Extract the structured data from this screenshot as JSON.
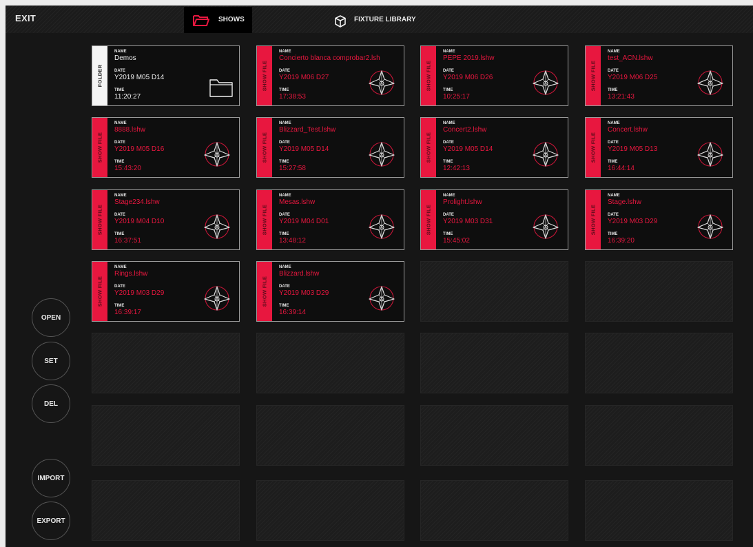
{
  "topbar": {
    "exit_label": "EXIT",
    "tabs": [
      {
        "label": "SHOWS",
        "icon": "folder-open-icon",
        "active": true
      },
      {
        "label": "FIXTURE LIBRARY",
        "icon": "cube-icon",
        "active": false
      }
    ]
  },
  "colors": {
    "accent": "#e8173f",
    "background": "#161616",
    "folder_strip": "#f4f4f4"
  },
  "sidebar": {
    "buttons": [
      {
        "label": "OPEN"
      },
      {
        "label": "SET"
      },
      {
        "label": "DEL"
      },
      {
        "label": "IMPORT"
      },
      {
        "label": "EXPORT"
      }
    ]
  },
  "field_labels": {
    "name": "NAME",
    "date": "DATE",
    "time": "TIME"
  },
  "shows": [
    {
      "kind": "FOLDER",
      "icon": "folder-icon",
      "name": "Demos",
      "date": "Y2019 M05 D14",
      "time": "11:20:27"
    },
    {
      "kind": "SHOW FILE",
      "icon": "moving-head-icon",
      "name": "Concierto blanca comprobar2.lsh",
      "date": "Y2019 M06 D27",
      "time": "17:38:53"
    },
    {
      "kind": "SHOW FILE",
      "icon": "moving-head-icon",
      "name": "PEPE 2019.lshw",
      "date": "Y2019 M06 D26",
      "time": "10:25:17"
    },
    {
      "kind": "SHOW FILE",
      "icon": "moving-head-icon",
      "name": "test_ACN.lshw",
      "date": "Y2019 M06 D25",
      "time": "13:21:43"
    },
    {
      "kind": "SHOW FILE",
      "icon": "moving-head-icon",
      "name": "8888.lshw",
      "date": "Y2019 M05 D16",
      "time": "15:43:20"
    },
    {
      "kind": "SHOW FILE",
      "icon": "moving-head-icon",
      "name": "Blizzard_Test.lshw",
      "date": "Y2019 M05 D14",
      "time": "15:27:58"
    },
    {
      "kind": "SHOW FILE",
      "icon": "moving-head-icon",
      "name": "Concert2.lshw",
      "date": "Y2019 M05 D14",
      "time": "12:42:13"
    },
    {
      "kind": "SHOW FILE",
      "icon": "moving-head-icon",
      "name": "Concert.lshw",
      "date": "Y2019 M05 D13",
      "time": "16:44:14"
    },
    {
      "kind": "SHOW FILE",
      "icon": "moving-head-icon",
      "name": "Stage234.lshw",
      "date": "Y2019 M04 D10",
      "time": "16:37:51"
    },
    {
      "kind": "SHOW FILE",
      "icon": "moving-head-icon",
      "name": "Mesas.lshw",
      "date": "Y2019 M04 D01",
      "time": "13:48:12"
    },
    {
      "kind": "SHOW FILE",
      "icon": "moving-head-icon",
      "name": "Prolight.lshw",
      "date": "Y2019 M03 D31",
      "time": "15:45:02"
    },
    {
      "kind": "SHOW FILE",
      "icon": "moving-head-icon",
      "name": "Stage.lshw",
      "date": "Y2019 M03 D29",
      "time": "16:39:20"
    },
    {
      "kind": "SHOW FILE",
      "icon": "moving-head-icon",
      "name": "Rings.lshw",
      "date": "Y2019 M03 D29",
      "time": "16:39:17"
    },
    {
      "kind": "SHOW FILE",
      "icon": "moving-head-icon",
      "name": "Blizzard.lshw",
      "date": "Y2019 M03 D29",
      "time": "16:39:14"
    }
  ],
  "empty_slots": 14
}
